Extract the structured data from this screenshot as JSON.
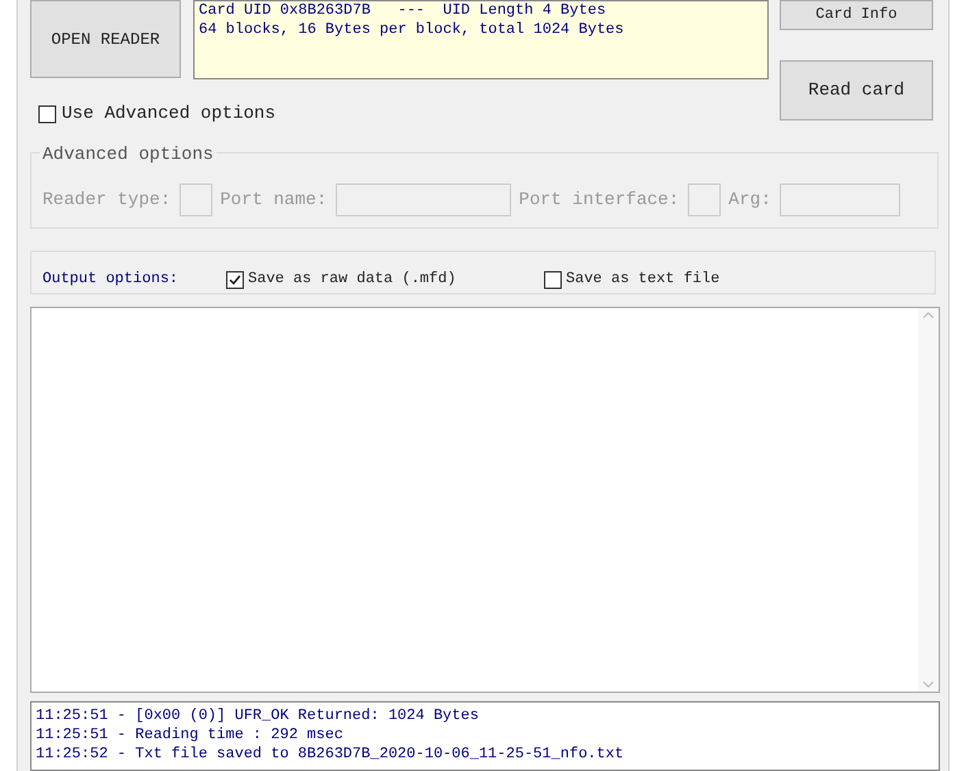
{
  "buttons": {
    "open_reader": "OPEN READER",
    "card_info": "Card Info",
    "read_card": "Read card"
  },
  "card_info_text": [
    "Card UID 0x8B263D7B   ---  UID Length 4 Bytes",
    "64 blocks, 16 Bytes per block, total 1024 Bytes"
  ],
  "use_advanced": {
    "label": "Use Advanced options",
    "checked": false
  },
  "advanced_options": {
    "title": "Advanced options",
    "disabled": true,
    "fields": [
      {
        "label": "Reader type:"
      },
      {
        "label": "Port name:"
      },
      {
        "label": "Port interface:"
      },
      {
        "label": "Arg:"
      }
    ]
  },
  "output_options": {
    "label": "Output options:",
    "checkboxes": [
      {
        "label": "Save as raw data (.mfd)",
        "checked": true
      },
      {
        "label": "Save as text file",
        "checked": false
      }
    ]
  },
  "log": [
    "11:25:51 - [0x00 (0)] UFR_OK Returned: 1024 Bytes",
    "11:25:51 - Reading time : 292 msec",
    "11:25:52 - Txt file saved to 8B263D7B_2020-10-06_11-25-51_nfo.txt"
  ]
}
